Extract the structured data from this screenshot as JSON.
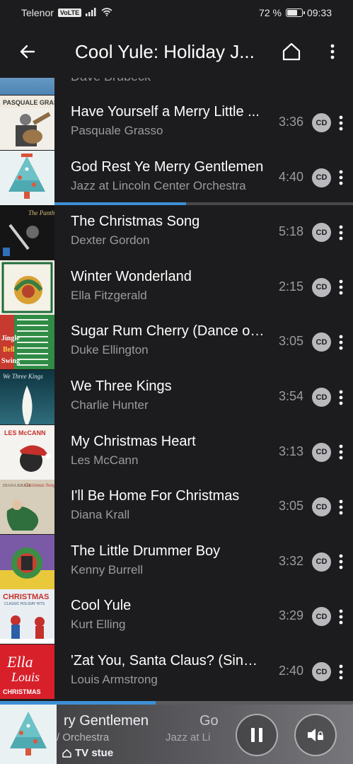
{
  "status_bar": {
    "carrier": "Telenor",
    "volte": "VoLTE",
    "battery": "72 %",
    "battery_level": 0.72,
    "time": "09:33"
  },
  "app_bar": {
    "title": "Cool Yule: Holiday J..."
  },
  "partial_row_artist": "Dave Brubeck",
  "tracks": [
    {
      "title": "Have Yourself a Merry Little ...",
      "artist": "Pasquale Grasso",
      "duration": "3:36",
      "badge": "CD",
      "cover": "pasquale-grasso-cover"
    },
    {
      "title": "God Rest Ye Merry Gentlemen",
      "artist": "Jazz at Lincoln Center Orchestra",
      "duration": "4:40",
      "badge": "CD",
      "cover": "christmas-tree-cover",
      "playing": true,
      "progress": 0.44
    },
    {
      "title": "The Christmas Song",
      "artist": "Dexter Gordon",
      "duration": "5:18",
      "badge": "CD",
      "cover": "dexter-gordon-cover"
    },
    {
      "title": "Winter Wonderland",
      "artist": "Ella Fitzgerald",
      "duration": "2:15",
      "badge": "CD",
      "cover": "ella-fitzgerald-cover"
    },
    {
      "title": "Sugar Rum Cherry (Dance of ...",
      "artist": "Duke Ellington",
      "duration": "3:05",
      "badge": "CD",
      "cover": "jingle-bell-swing-cover"
    },
    {
      "title": "We Three Kings",
      "artist": "Charlie Hunter",
      "duration": "3:54",
      "badge": "CD",
      "cover": "we-three-kings-cover"
    },
    {
      "title": "My Christmas Heart",
      "artist": "Les McCann",
      "duration": "3:13",
      "badge": "CD",
      "cover": "les-mccann-cover"
    },
    {
      "title": "I'll Be Home For Christmas",
      "artist": "Diana Krall",
      "duration": "3:05",
      "badge": "CD",
      "cover": "diana-krall-cover"
    },
    {
      "title": "The Little Drummer Boy",
      "artist": "Kenny Burrell",
      "duration": "3:32",
      "badge": "CD",
      "cover": "kenny-burrell-cover"
    },
    {
      "title": "Cool Yule",
      "artist": "Kurt Elling",
      "duration": "3:29",
      "badge": "CD",
      "cover": "classic-holiday-hits-cover"
    },
    {
      "title": "'Zat You, Santa Claus? (Singl...",
      "artist": "Louis Armstrong",
      "duration": "2:40",
      "badge": "CD",
      "cover": "ella-louis-christmas-cover"
    }
  ],
  "now_playing": {
    "title": "ry Gentlemen",
    "artist": "/ Orchestra",
    "ghost_title": "Go",
    "ghost_artist": "Jazz at Li",
    "room": "TV stue",
    "progress": 0.44
  },
  "accent_color": "#3d8fd6"
}
